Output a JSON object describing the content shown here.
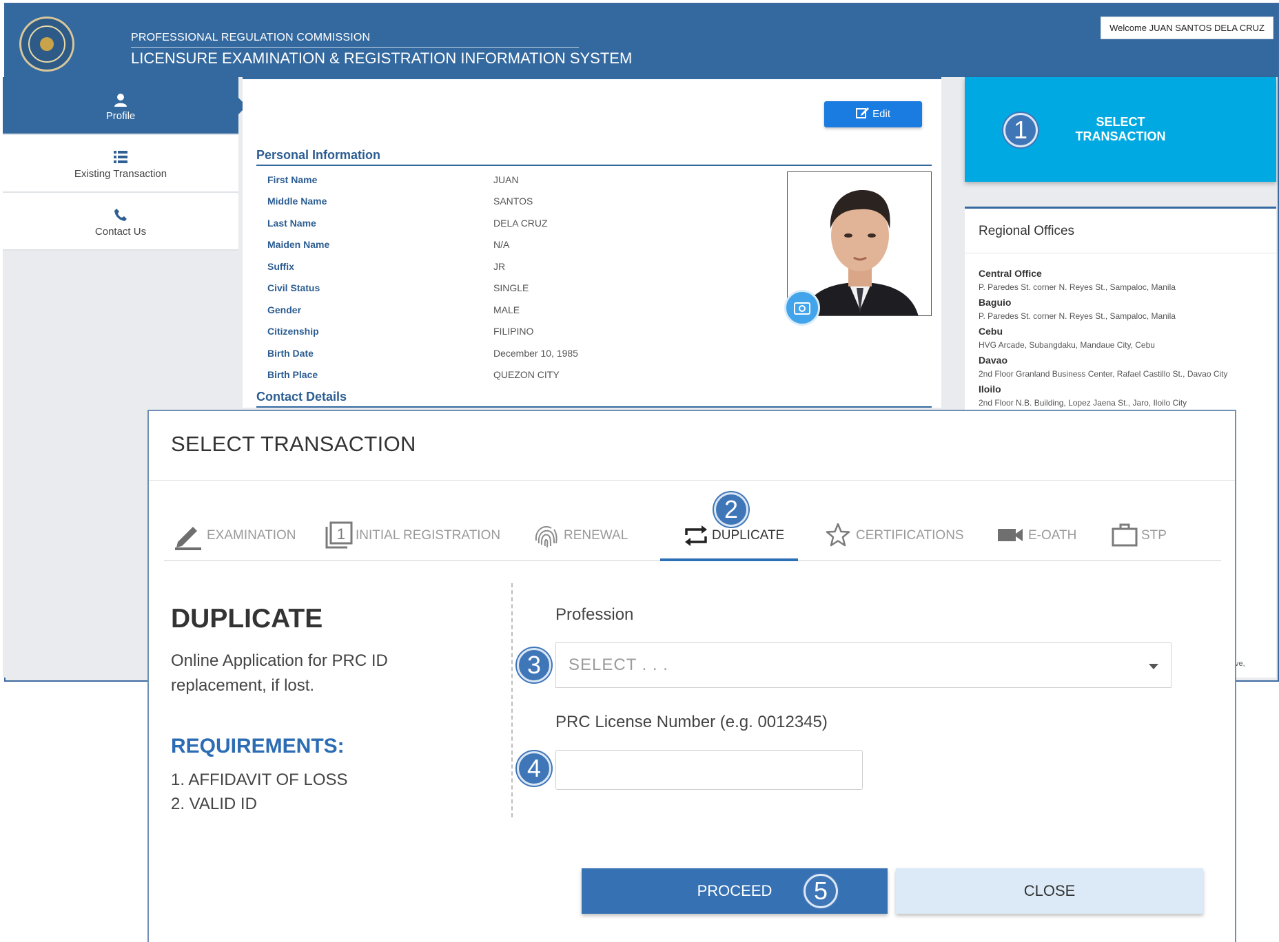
{
  "header": {
    "org": "PROFESSIONAL REGULATION COMMISSION",
    "system": "LICENSURE EXAMINATION & REGISTRATION INFORMATION SYSTEM",
    "welcome": "Welcome JUAN SANTOS DELA CRUZ"
  },
  "sidebar": {
    "items": [
      {
        "label": "Profile",
        "icon": "user-icon"
      },
      {
        "label": "Existing Transaction",
        "icon": "list-icon"
      },
      {
        "label": "Contact Us",
        "icon": "phone-icon"
      }
    ]
  },
  "profile": {
    "edit_label": "Edit",
    "personal_title": "Personal Information",
    "contact_title": "Contact Details",
    "fields": [
      {
        "label": "First Name",
        "value": "JUAN"
      },
      {
        "label": "Middle Name",
        "value": "SANTOS"
      },
      {
        "label": "Last Name",
        "value": "DELA CRUZ"
      },
      {
        "label": "Maiden Name",
        "value": "N/A"
      },
      {
        "label": "Suffix",
        "value": "JR"
      },
      {
        "label": "Civil Status",
        "value": "SINGLE"
      },
      {
        "label": "Gender",
        "value": "MALE"
      },
      {
        "label": "Citizenship",
        "value": "FILIPINO"
      },
      {
        "label": "Birth Date",
        "value": "December 10, 1985"
      },
      {
        "label": "Birth Place",
        "value": "QUEZON CITY"
      }
    ]
  },
  "select_card": {
    "line1": "SELECT",
    "line2": "TRANSACTION"
  },
  "regional": {
    "title": "Regional Offices",
    "offices": [
      {
        "name": "Central Office",
        "address": "P. Paredes St. corner N. Reyes St., Sampaloc, Manila"
      },
      {
        "name": "Baguio",
        "address": "P. Paredes St. corner N. Reyes St., Sampaloc, Manila"
      },
      {
        "name": "Cebu",
        "address": "HVG Arcade, Subangdaku, Mandaue City, Cebu"
      },
      {
        "name": "Davao",
        "address": "2nd Floor Granland Business Center, Rafael Castillo St., Davao City"
      },
      {
        "name": "Iloilo",
        "address": "2nd Floor N.B. Building, Lopez Jaena St., Jaro, Iloilo City"
      }
    ],
    "stub": "ve,"
  },
  "modal": {
    "title": "SELECT TRANSACTION",
    "tabs": [
      {
        "label": "EXAMINATION",
        "icon": "pencil-icon"
      },
      {
        "label": "INITIAL REGISTRATION",
        "icon": "number-one-icon"
      },
      {
        "label": "RENEWAL",
        "icon": "fingerprint-icon"
      },
      {
        "label": "DUPLICATE",
        "icon": "repeat-icon"
      },
      {
        "label": "CERTIFICATIONS",
        "icon": "star-icon"
      },
      {
        "label": "E-OATH",
        "icon": "video-camera-icon"
      },
      {
        "label": "STP",
        "icon": "briefcase-icon"
      }
    ],
    "active_tab": "DUPLICATE",
    "heading": "DUPLICATE",
    "description": "Online Application for PRC ID replacement, if lost.",
    "requirements_title": "REQUIREMENTS:",
    "requirements": [
      "1. AFFIDAVIT OF LOSS",
      "2. VALID ID"
    ],
    "profession_label": "Profession",
    "profession_placeholder": "SELECT . . .",
    "license_label": "PRC License Number (e.g. 0012345)",
    "license_value": "",
    "proceed_label": "PROCEED",
    "close_label": "CLOSE"
  },
  "steps": [
    "1",
    "2",
    "3",
    "4",
    "5"
  ],
  "colors": {
    "header": "#34699f",
    "accent": "#00a9e2",
    "primary_button": "#3571b3",
    "close_button": "#dbeaf6",
    "step_marker": "#3f76b8"
  }
}
